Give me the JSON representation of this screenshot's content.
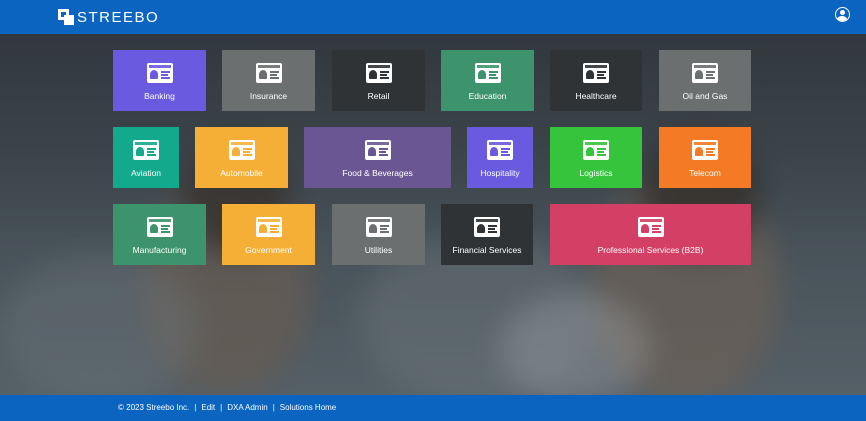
{
  "header": {
    "logo_text": "STREEBO",
    "user_icon": "user-circle-icon"
  },
  "tile_icon": "id-card-icon",
  "tiles": [
    {
      "label": "Banking",
      "color": "#6a5ae0"
    },
    {
      "label": "Insurance",
      "color": "#6c6f70"
    },
    {
      "label": "Retail",
      "color": "#2f3336"
    },
    {
      "label": "Education",
      "color": "#3d936b"
    },
    {
      "label": "Healthcare",
      "color": "#2f3336"
    },
    {
      "label": "Oil and Gas",
      "color": "#6c6f70"
    },
    {
      "label": "Aviation",
      "color": "#13a98c"
    },
    {
      "label": "Automobile",
      "color": "#f6af36"
    },
    {
      "label": "Food & Beverages",
      "color": "#6b5694"
    },
    {
      "label": "Hospitality",
      "color": "#6a5ae0"
    },
    {
      "label": "Logistics",
      "color": "#35c43c"
    },
    {
      "label": "Telecom",
      "color": "#f47a26"
    },
    {
      "label": "Manufacturing",
      "color": "#3d936b"
    },
    {
      "label": "Government",
      "color": "#f6af36"
    },
    {
      "label": "Utilities",
      "color": "#6c6f70"
    },
    {
      "label": "Financial Services",
      "color": "#2f3336"
    },
    {
      "label": "Professional Services (B2B)",
      "color": "#d43f65"
    }
  ],
  "footer": {
    "copyright": "© 2023 Streebo Inc.",
    "separator": "|",
    "links": [
      "Edit",
      "DXA Admin",
      "Solutions Home"
    ]
  }
}
